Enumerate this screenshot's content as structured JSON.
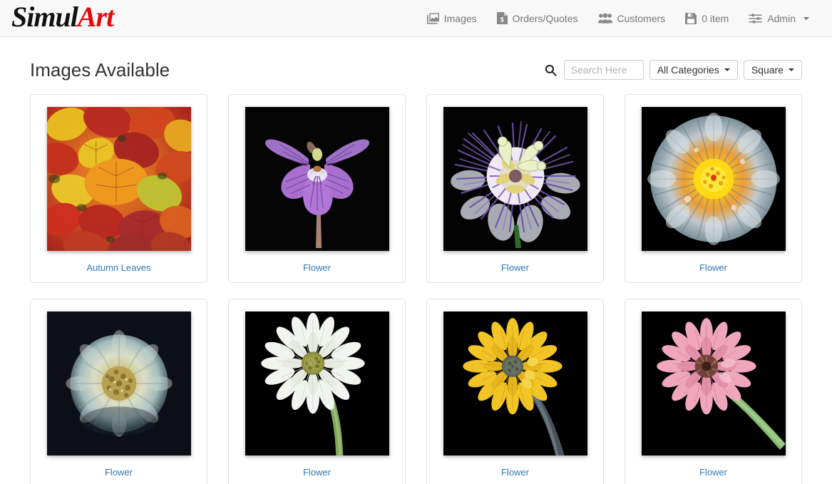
{
  "header": {
    "brand_part1": "Simul",
    "brand_part2": "Art",
    "nav": [
      {
        "label": "Images",
        "icon": "images-icon"
      },
      {
        "label": "Orders/Quotes",
        "icon": "orders-quotes-icon"
      },
      {
        "label": "Customers",
        "icon": "customers-icon"
      },
      {
        "label": "0 item",
        "icon": "save-cart-icon"
      },
      {
        "label": "Admin",
        "icon": "admin-sliders-icon",
        "has_caret": true
      }
    ]
  },
  "main": {
    "page_title": "Images Available",
    "search": {
      "icon": "search-icon",
      "value": "",
      "placeholder": "Search Here"
    },
    "category_filter": {
      "label": "All Categories"
    },
    "shape_filter": {
      "label": "Square"
    },
    "cards": [
      {
        "caption": "Autumn Leaves",
        "image": "autumn-leaves-thumbnail"
      },
      {
        "caption": "Flower",
        "image": "purple-violet-thumbnail"
      },
      {
        "caption": "Flower",
        "image": "passion-flower-thumbnail"
      },
      {
        "caption": "Flower",
        "image": "orange-dahlia-thumbnail"
      },
      {
        "caption": "Flower",
        "image": "pale-dahlia-thumbnail"
      },
      {
        "caption": "Flower",
        "image": "white-gerbera-thumbnail"
      },
      {
        "caption": "Flower",
        "image": "yellow-gerbera-thumbnail"
      },
      {
        "caption": "Flower",
        "image": "pink-gerbera-thumbnail"
      }
    ]
  },
  "colors": {
    "link": "#337ab7",
    "brand_red": "#e00b0b",
    "nav_text": "#777777",
    "header_bg": "#f8f8f8"
  }
}
